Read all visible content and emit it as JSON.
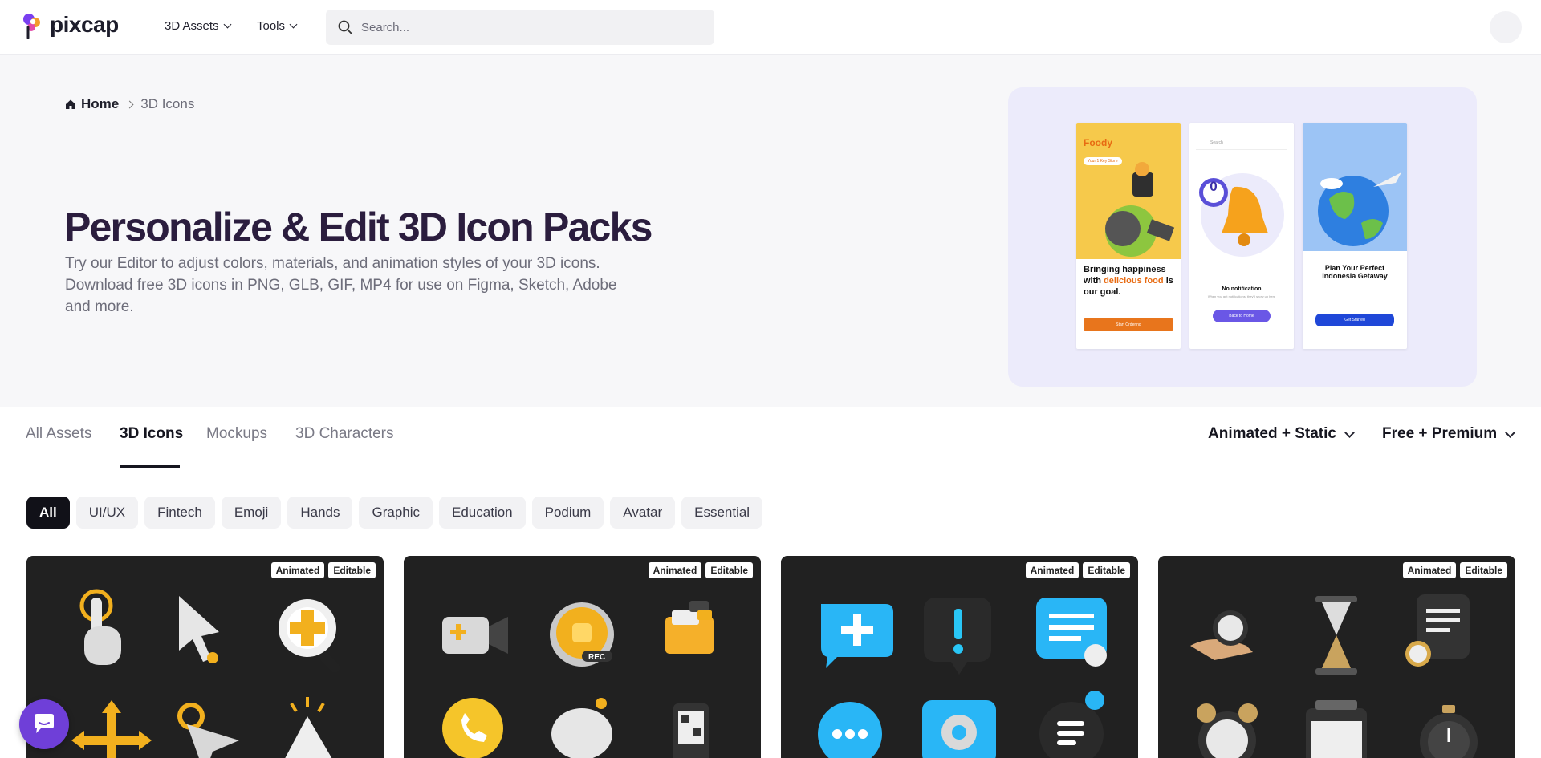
{
  "header": {
    "logo_text": "pixcap",
    "nav": [
      {
        "label": "3D Assets"
      },
      {
        "label": "Tools"
      }
    ],
    "search_placeholder": "Search..."
  },
  "hero": {
    "breadcrumb": {
      "home": "Home",
      "current": "3D Icons"
    },
    "title": "Personalize & Edit 3D Icon Packs",
    "description": "Try our Editor to adjust colors, materials, and animation styles of your 3D icons. Download free 3D icons in PNG, GLB, GIF, MP4 for use on Figma, Sketch, Adobe and more.",
    "preview": {
      "phone1": {
        "brand": "Foody",
        "pill": "Your 1 Key Store",
        "text_a": "Bringing happiness with",
        "text_b": "delicious food",
        "text_c": "is our goal.",
        "button": "Start Ordering"
      },
      "phone2": {
        "search": "Search",
        "badge": "0",
        "title": "No notification",
        "sub": "When you get notifications, they'll show up here",
        "button": "Back to Home"
      },
      "phone3": {
        "title": "Plan Your Perfect Indonesia Getaway",
        "button": "Get Started"
      }
    }
  },
  "tabs": {
    "items": [
      "All Assets",
      "3D Icons",
      "Mockups",
      "3D Characters"
    ],
    "active": "3D Icons",
    "filters": [
      "Animated + Static",
      "Free + Premium"
    ]
  },
  "chips": [
    "All",
    "UI/UX",
    "Fintech",
    "Emoji",
    "Hands",
    "Graphic",
    "Education",
    "Podium",
    "Avatar",
    "Essential"
  ],
  "cards": [
    {
      "badges": [
        "Animated",
        "Editable"
      ],
      "theme": "cursor-pack"
    },
    {
      "badges": [
        "Animated",
        "Editable"
      ],
      "theme": "media-pack"
    },
    {
      "badges": [
        "Animated",
        "Editable"
      ],
      "theme": "chat-pack"
    },
    {
      "badges": [
        "Animated",
        "Editable"
      ],
      "theme": "time-pack"
    }
  ],
  "colors": {
    "accent_purple": "#6f3fd8",
    "hero_bg": "#f7f7f9",
    "panel_bg": "#ecebfb",
    "card_bg": "#212121",
    "title": "#2b1d3e"
  }
}
